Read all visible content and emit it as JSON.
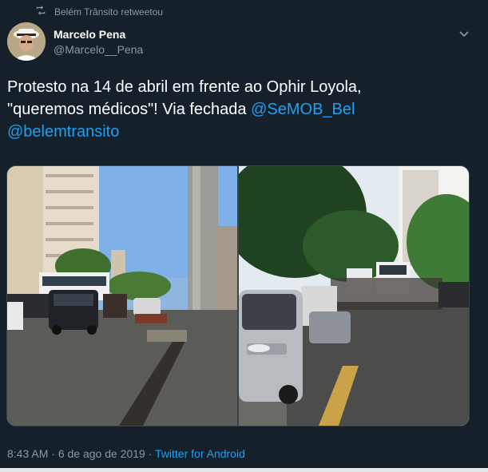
{
  "retweet": {
    "text": "Belém Trânsito retweetou"
  },
  "author": {
    "name": "Marcelo Pena",
    "handle": "@Marcelo__Pena"
  },
  "tweet": {
    "text_line1": "Protesto na 14 de abril em frente ao Ophir Loyola,",
    "text_line2_prefix": "\"queremos médicos\"! Via fechada ",
    "mention1": "@SeMOB_Bel",
    "mention2": "@belemtransito"
  },
  "meta": {
    "time": "8:43 AM",
    "separator1": " · ",
    "date": "6 de ago de 2019",
    "separator2": " · ",
    "source": "Twitter for Android"
  },
  "icons": {
    "retweet": "retweet-icon",
    "caret": "chevron-down-icon",
    "avatar": "profile-photo"
  },
  "colors": {
    "background": "#15202b",
    "text": "#ffffff",
    "secondary": "#8899a6",
    "link": "#1da1f2",
    "border": "#38444d"
  }
}
